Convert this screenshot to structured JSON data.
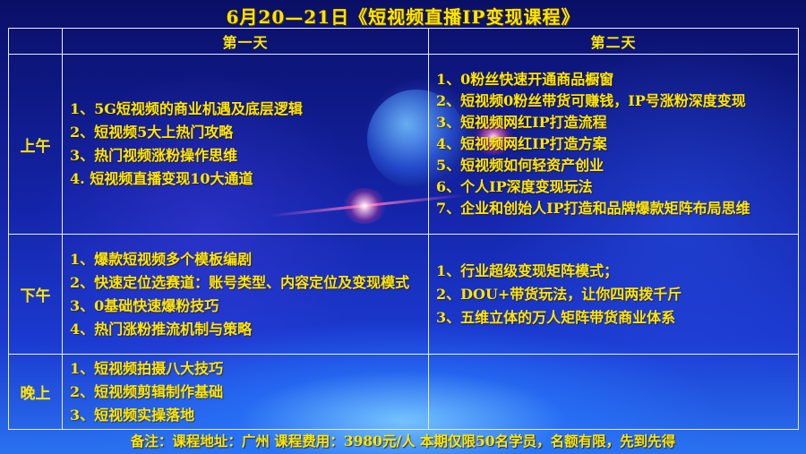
{
  "title": "6月20—21日《短视频直播IP变现课程》",
  "header": {
    "day1": "第一天",
    "day2": "第二天"
  },
  "rows": {
    "am": {
      "label": "上午",
      "day1": [
        "1、5G短视频的商业机遇及底层逻辑",
        "2、短视频5大上热门攻略",
        "3、热门视频涨粉操作思维",
        "4. 短视频直播变现10大通道"
      ],
      "day2": [
        "1、0粉丝快速开通商品橱窗",
        "2、短视频0粉丝带货可赚钱，IP号涨粉深度变现",
        "3、短视频网红IP打造流程",
        "4、短视频网红IP打造方案",
        "5、短视频如何轻资产创业",
        "6、个人IP深度变现玩法",
        "7、企业和创始人IP打造和品牌爆款矩阵布局思维"
      ]
    },
    "pm": {
      "label": "下午",
      "day1": [
        "1、爆款短视频多个模板编剧",
        "2、快速定位选赛道：账号类型、内容定位及变现模式",
        "3、0基础快速爆粉技巧",
        "4、热门涨粉推流机制与策略"
      ],
      "day2": [
        "1、行业超级变现矩阵模式；",
        "2、DOU+带货玩法，让你四两拨千斤",
        "3、五维立体的万人矩阵带货商业体系"
      ]
    },
    "ev": {
      "label": "晚上",
      "day1": [
        "1、短视频拍摄八大技巧",
        "2、短视频剪辑制作基础",
        "3、短视频实操落地"
      ],
      "day2": []
    }
  },
  "footer": "备注：课程地址：广州   课程费用：3980元/人   本期仅限50名学员，名额有限，先到先得",
  "colors": {
    "text": "#ffe600",
    "border": "#e6ecff",
    "background": "#1424a8"
  }
}
